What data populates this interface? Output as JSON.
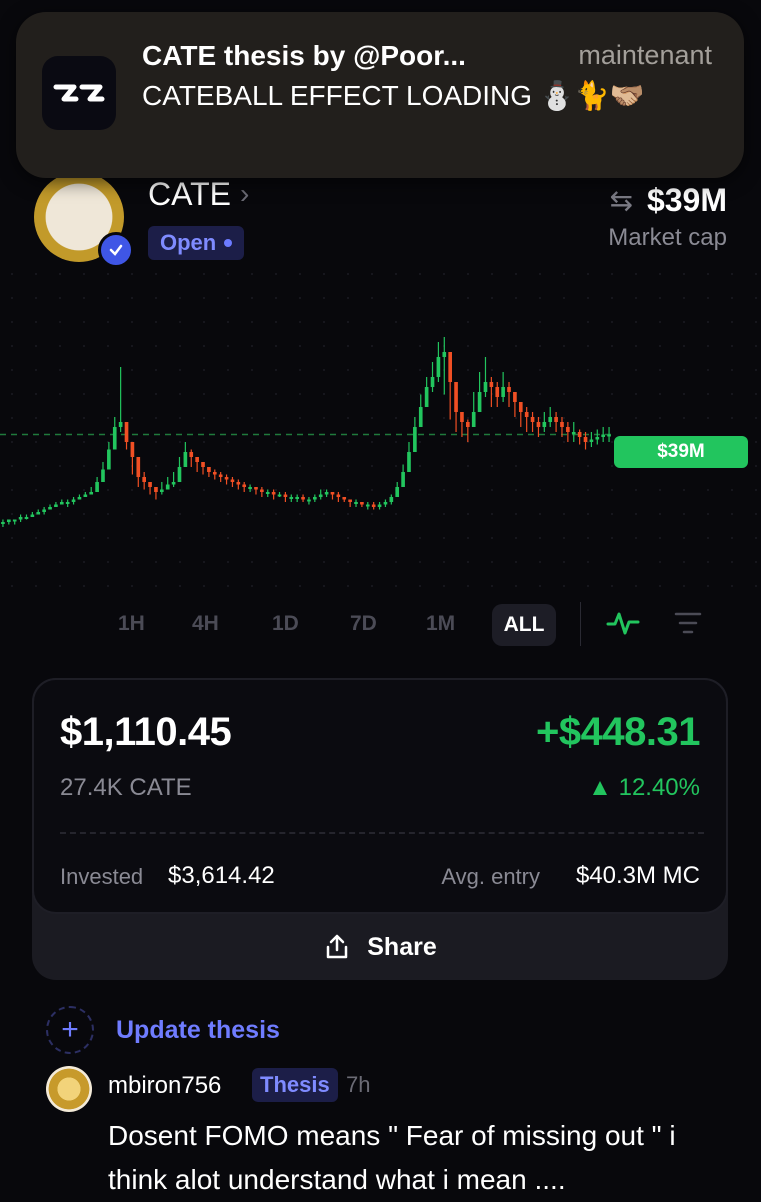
{
  "notification": {
    "title": "CATE thesis by @Poor...",
    "time": "maintenant",
    "body": "CATEBALL EFFECT LOADING ⛄🐈🫱🏼‍🫲🏽",
    "app_icon": "app-logo-icon"
  },
  "token": {
    "name": "CATE",
    "status": "Open",
    "market_cap": "$39M",
    "market_cap_label": "Market cap"
  },
  "chart": {
    "current_price_label": "$39M",
    "up_color": "#22c55e",
    "down_color": "#f04f24"
  },
  "chart_data": {
    "type": "candlestick",
    "unit": "market cap ($M)",
    "current_value": 39,
    "candles": [
      [
        4,
        4,
        2,
        5
      ],
      [
        5,
        5,
        3,
        5
      ],
      [
        5,
        5,
        3,
        5
      ],
      [
        6,
        6,
        4,
        7
      ],
      [
        6,
        6,
        5,
        7
      ],
      [
        7,
        7,
        6,
        8
      ],
      [
        8,
        8,
        7,
        9
      ],
      [
        9,
        9,
        7,
        10
      ],
      [
        10,
        10,
        9,
        11
      ],
      [
        11,
        11,
        10,
        12
      ],
      [
        12,
        12,
        11,
        13
      ],
      [
        12,
        12,
        10,
        13
      ],
      [
        13,
        13,
        11,
        14
      ],
      [
        14,
        14,
        13,
        15
      ],
      [
        15,
        15,
        14,
        16
      ],
      [
        16,
        16,
        15,
        18
      ],
      [
        20,
        20,
        16,
        22
      ],
      [
        25,
        25,
        20,
        28
      ],
      [
        33,
        33,
        25,
        36
      ],
      [
        42,
        42,
        33,
        46
      ],
      [
        44,
        44,
        40,
        66
      ],
      [
        36,
        36,
        33,
        40
      ],
      [
        30,
        30,
        23,
        32
      ],
      [
        22,
        22,
        18,
        25
      ],
      [
        20,
        20,
        17,
        24
      ],
      [
        18,
        18,
        15,
        20
      ],
      [
        16,
        16,
        13,
        18
      ],
      [
        17,
        17,
        15,
        20
      ],
      [
        19,
        19,
        17,
        22
      ],
      [
        20,
        20,
        18,
        24
      ],
      [
        26,
        26,
        20,
        30
      ],
      [
        32,
        32,
        26,
        36
      ],
      [
        30,
        30,
        26,
        33
      ],
      [
        28,
        28,
        24,
        30
      ],
      [
        26,
        26,
        23,
        28
      ],
      [
        24,
        24,
        22,
        26
      ],
      [
        23,
        23,
        21,
        25
      ],
      [
        22,
        22,
        20,
        24
      ],
      [
        21,
        21,
        19,
        23
      ],
      [
        20,
        20,
        18,
        22
      ],
      [
        19,
        19,
        17,
        21
      ],
      [
        18,
        18,
        16,
        20
      ],
      [
        18,
        18,
        16,
        19
      ],
      [
        17,
        17,
        15,
        18
      ],
      [
        16,
        16,
        14,
        18
      ],
      [
        16,
        16,
        14,
        17
      ],
      [
        15,
        15,
        13,
        17
      ],
      [
        15,
        15,
        14,
        16
      ],
      [
        14,
        14,
        12,
        16
      ],
      [
        14,
        14,
        12,
        15
      ],
      [
        14,
        14,
        12,
        15
      ],
      [
        13,
        13,
        12,
        15
      ],
      [
        13,
        13,
        11,
        14
      ],
      [
        14,
        14,
        12,
        15
      ],
      [
        15,
        15,
        13,
        17
      ],
      [
        16,
        16,
        14,
        17
      ],
      [
        15,
        15,
        13,
        16
      ],
      [
        14,
        14,
        12,
        16
      ],
      [
        13,
        13,
        12,
        14
      ],
      [
        12,
        12,
        10,
        13
      ],
      [
        12,
        12,
        10,
        13
      ],
      [
        11,
        11,
        10,
        12
      ],
      [
        11,
        11,
        9,
        12
      ],
      [
        10,
        10,
        9,
        12
      ],
      [
        11,
        11,
        9,
        12
      ],
      [
        12,
        12,
        10,
        13
      ],
      [
        14,
        14,
        11,
        15
      ],
      [
        18,
        18,
        14,
        20
      ],
      [
        24,
        24,
        18,
        27
      ],
      [
        32,
        32,
        24,
        36
      ],
      [
        42,
        42,
        32,
        46
      ],
      [
        50,
        50,
        42,
        55
      ],
      [
        58,
        58,
        50,
        62
      ],
      [
        62,
        62,
        56,
        68
      ],
      [
        70,
        70,
        60,
        76
      ],
      [
        72,
        72,
        55,
        78
      ],
      [
        60,
        60,
        45,
        66
      ],
      [
        48,
        48,
        40,
        50
      ],
      [
        44,
        44,
        38,
        48
      ],
      [
        42,
        42,
        36,
        45
      ],
      [
        48,
        48,
        42,
        56
      ],
      [
        56,
        56,
        48,
        64
      ],
      [
        60,
        60,
        54,
        70
      ],
      [
        58,
        58,
        50,
        62
      ],
      [
        54,
        54,
        50,
        60
      ],
      [
        58,
        58,
        52,
        64
      ],
      [
        56,
        56,
        50,
        60
      ],
      [
        52,
        52,
        46,
        56
      ],
      [
        48,
        48,
        42,
        52
      ],
      [
        46,
        46,
        40,
        50
      ],
      [
        44,
        44,
        40,
        48
      ],
      [
        42,
        42,
        38,
        46
      ],
      [
        44,
        44,
        40,
        48
      ],
      [
        46,
        46,
        42,
        50
      ],
      [
        44,
        44,
        40,
        48
      ],
      [
        42,
        42,
        38,
        46
      ],
      [
        40,
        40,
        36,
        44
      ],
      [
        40,
        40,
        36,
        44
      ],
      [
        38,
        38,
        35,
        41
      ],
      [
        36,
        36,
        33,
        40
      ],
      [
        37,
        37,
        34,
        40
      ],
      [
        38,
        38,
        35,
        41
      ],
      [
        39,
        39,
        36,
        42
      ],
      [
        39,
        39,
        36,
        42
      ]
    ]
  },
  "ranges": {
    "items": [
      "1H",
      "4H",
      "1D",
      "7D",
      "1M"
    ],
    "selected": "ALL"
  },
  "position": {
    "value": "$1,110.45",
    "pnl": "+$448.31",
    "quantity": "27.4K CATE",
    "pnl_percent": "▲ 12.40%",
    "invested_label": "Invested",
    "invested": "$3,614.42",
    "avg_entry_label": "Avg. entry",
    "avg_entry": "$40.3M MC",
    "share_label": "Share"
  },
  "update_thesis": {
    "label": "Update thesis"
  },
  "comment": {
    "user": "mbiron756",
    "badge": "Thesis",
    "time": "7h",
    "text": "Dosent FOMO means \" Fear of missing out \" i think alot understand what i mean ...."
  }
}
